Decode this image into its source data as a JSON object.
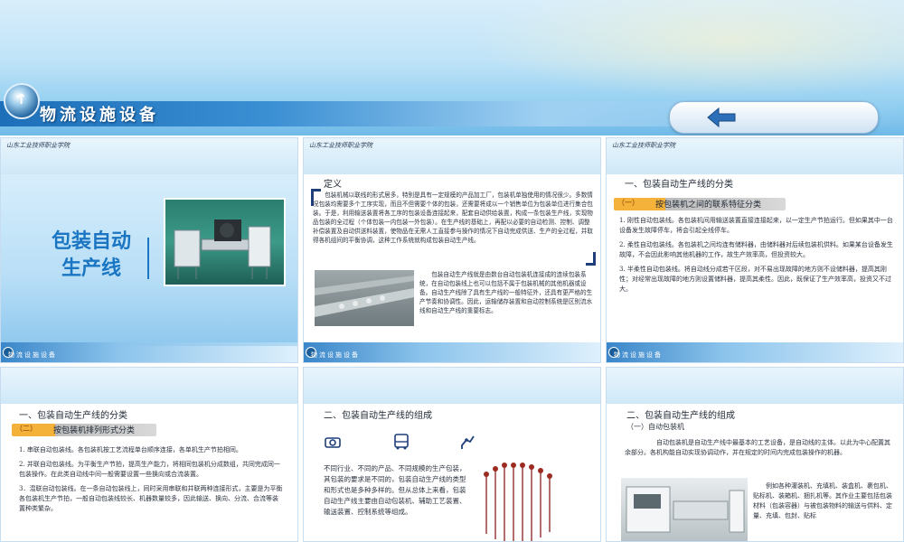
{
  "banner": {
    "title": "物流设施设备"
  },
  "panels": {
    "p1": {
      "school": "山东工业技师职业学院",
      "title_line1": "包装自动",
      "title_line2": "生产线",
      "footer": "物流设施设备"
    },
    "p2": {
      "school": "山东工业技师职业学院",
      "heading": "定义",
      "definition": "包装机械以联线的形式居多，特别是具有一定规模的产品加工厂，包装机单独使用的情况很少。多数情况包装均需要多个工序实现，而且不但需要个体的包装，还需要将成以一个销售单位为包装单位进行集合包装。于是，利用输送装置将各工序的包装设备连接起来，配套自动供给装置，构成一条包装生产线，实现物品包装的全过程（个体包装一内包装一外包装）。在生产线的基础上，再配以必要的自动检测、控制、调整补偿装置及自动供送料装置，使物品在无需人工直接参与操作的情况下自动完成供送、生产的全过程，并取得各机组间的平衡协调，这种工作系统就构成包装自动生产线。",
      "summary": "包装自动生产线就是由数台自动包装机连接成的连续包装系统，在自动包装线上也可以包括不属于包装机械的其他机器或设备。自动生产线除了具有生产线的一般特征外，还具有更严格的生产节奏和协调性。因此，运输储存装置和自动控制系统是区别流水线和自动生产线的重要标志。",
      "footer": "物流设施设备"
    },
    "p3": {
      "school": "山东工业技师职业学院",
      "heading": "一、包装自动生产线的分类",
      "pill_num": "（一）",
      "pill_text": "按包装机之间的联系特征分类",
      "items": [
        "1. 刚性自动包装线。各包装机间用输送装置直接连接起来，以一定生产节拍运行。但如果其中一台设备发生故障停车，将会引起全线停车。",
        "2. 柔性自动包装线。各包装机之间均连有储料器，由储料器对后续包装机供料。如果某台设备发生故障，不会因此影响其他机器的工作，故生产效率高，但投资较大。",
        "3. 半柔性自动包装线。将自动线分成若干区段，对不易出现故障的地方则不设储料器，提高其刚性；对经常出现故障的地方则设置储料器，提高其柔性。因此，既保证了生产效率高，投资又不过大。"
      ],
      "footer": "物流设施设备"
    },
    "p4": {
      "heading": "一、包装自动生产线的分类",
      "pill_num": "（二）",
      "pill_text": "按包装机排列形式分类",
      "items": [
        "1. 串联自动包装线。各包装机按工艺流程单台顺序连接，各单机生产节拍相同。",
        "2. 并联自动包装线。为平衡生产节拍，提高生产能力，将相同包装机分成数组，共同完成同一包装操作。在此类自动线中间一般需要设置一些换向或合流装置。",
        "3．混联自动包装线。在一条自动包装线上，同时采用串联和并联两种连接形式，主要是为平衡各包装机生产节拍，一般自动包装线较长、机器数量较多，因此输送、换向、分流、合流等装置种类繁杂。"
      ]
    },
    "p5": {
      "heading": "二、包装自动生产线的组成",
      "body": "不同行业、不同的产品、不同规模的生产包装，其包装的要求是不同的，包装自动生产线的类型和形式也是多种多样的。但从总体上来看，包装自动生产线主要由自动包装机、辅助工艺装置、输送装置、控制系统等组成。"
    },
    "p6": {
      "heading": "二、包装自动生产线的组成",
      "sub": "（一）自动包装机",
      "body": "自动包装机是自动生产线中最基本的工艺设备，是自动线的主体。以此为中心配置其余部分。各机构能自动实现协调动作，并在规定的时间内完成包装操作的机器。",
      "example": "例如各种灌装机、充填机、装盒机、裹包机、贴标机、装箱机、捆扎机等。其作业主要包括包装材料（包装容器）与被包装物料的输送与供料、定量、充填、包封、贴标"
    }
  }
}
